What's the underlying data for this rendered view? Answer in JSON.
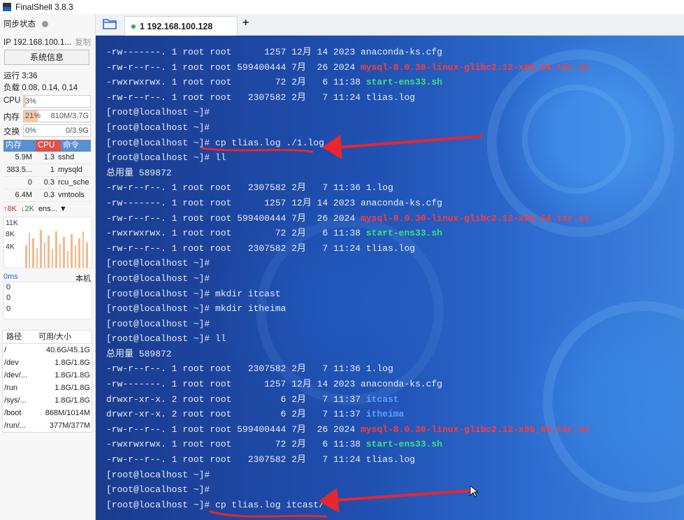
{
  "app": {
    "title": "FinalShell 3.8.3"
  },
  "sidebar": {
    "sync_label": "同步状态",
    "ip_label": "IP 192.168.100.1...",
    "copy_label": "复制",
    "sysinfo_button": "系统信息",
    "uptime": "运行 3:36",
    "load": "负载 0.08, 0.14, 0.14",
    "cpu": {
      "label": "CPU",
      "value": "3%",
      "fraction": 0.03
    },
    "mem": {
      "label": "内存",
      "value": "21%",
      "detail": "810M/3.7G",
      "fraction": 0.21
    },
    "swap": {
      "label": "交换",
      "value": "0%",
      "detail": "0/3.9G",
      "fraction": 0.0
    },
    "process_headers": [
      "内存",
      "CPU",
      "命令"
    ],
    "processes": [
      {
        "mem": "5.9M",
        "cpu": "1.3",
        "cmd": "sshd"
      },
      {
        "mem": "383.5...",
        "cpu": "1",
        "cmd": "mysqld"
      },
      {
        "mem": "0",
        "cpu": "0.3",
        "cmd": "rcu_sche"
      },
      {
        "mem": "6.4M",
        "cpu": "0.3",
        "cmd": "vmtools"
      }
    ],
    "net": {
      "up": "8K",
      "down": "2K",
      "iface": "ens...",
      "y_labels": [
        "11K",
        "8K",
        "4K"
      ]
    },
    "latency": {
      "label": "0ms",
      "host": "本机",
      "values": [
        "0",
        "0",
        "0"
      ]
    },
    "disk": {
      "headers": [
        "路径",
        "可用/大小"
      ],
      "rows": [
        {
          "path": "/",
          "size": "40.6G/45.1G"
        },
        {
          "path": "/dev",
          "size": "1.8G/1.8G"
        },
        {
          "path": "/dev/...",
          "size": "1.8G/1.8G"
        },
        {
          "path": "/run",
          "size": "1.8G/1.8G"
        },
        {
          "path": "/sys/...",
          "size": "1.8G/1.8G"
        },
        {
          "path": "/boot",
          "size": "868M/1014M"
        },
        {
          "path": "/run/...",
          "size": "377M/377M"
        }
      ]
    }
  },
  "tabs": [
    {
      "label": "1 192.168.100.128"
    }
  ],
  "add_tab": "+",
  "colors": {
    "red": "#ff3b3b",
    "green": "#3ee07a",
    "blue": "#5aa0ff",
    "arrow": "#e8262e"
  },
  "terminal": {
    "lines": [
      [
        {
          "t": "-rw-------. 1 root root      1257 12月 14 2023 anaconda-ks.cfg"
        }
      ],
      [
        {
          "t": "-rw-r--r--. 1 root root 599400444 7月  26 2024 "
        },
        {
          "t": "mysql-8.0.30-linux-glibc2.12-x86_64.tar.xz",
          "c": "red"
        }
      ],
      [
        {
          "t": "-rwxrwxrwx. 1 root root        72 2月   6 11:38 "
        },
        {
          "t": "start-ens33.sh",
          "c": "green"
        }
      ],
      [
        {
          "t": "-rw-r--r--. 1 root root   2307582 2月   7 11:24 tlias.log"
        }
      ],
      [
        {
          "t": "[root@localhost ~]#"
        }
      ],
      [
        {
          "t": "[root@localhost ~]#"
        }
      ],
      [
        {
          "t": "[root@localhost ~]# cp tlias.log ./1.log"
        }
      ],
      [
        {
          "t": "[root@localhost ~]# ll"
        }
      ],
      [
        {
          "t": "总用量 589872"
        }
      ],
      [
        {
          "t": "-rw-r--r--. 1 root root   2307582 2月   7 11:36 1.log"
        }
      ],
      [
        {
          "t": "-rw-------. 1 root root      1257 12月 14 2023 anaconda-ks.cfg"
        }
      ],
      [
        {
          "t": "-rw-r--r--. 1 root root 599400444 7月  26 2024 "
        },
        {
          "t": "mysql-8.0.30-linux-glibc2.12-x86_64.tar.xz",
          "c": "red"
        }
      ],
      [
        {
          "t": "-rwxrwxrwx. 1 root root        72 2月   6 11:38 "
        },
        {
          "t": "start-ens33.sh",
          "c": "green"
        }
      ],
      [
        {
          "t": "-rw-r--r--. 1 root root   2307582 2月   7 11:24 tlias.log"
        }
      ],
      [
        {
          "t": "[root@localhost ~]#"
        }
      ],
      [
        {
          "t": "[root@localhost ~]#"
        }
      ],
      [
        {
          "t": "[root@localhost ~]# mkdir itcast"
        }
      ],
      [
        {
          "t": "[root@localhost ~]# mkdir itheima"
        }
      ],
      [
        {
          "t": "[root@localhost ~]#"
        }
      ],
      [
        {
          "t": "[root@localhost ~]# ll"
        }
      ],
      [
        {
          "t": "总用量 589872"
        }
      ],
      [
        {
          "t": "-rw-r--r--. 1 root root   2307582 2月   7 11:36 1.log"
        }
      ],
      [
        {
          "t": "-rw-------. 1 root root      1257 12月 14 2023 anaconda-ks.cfg"
        }
      ],
      [
        {
          "t": "drwxr-xr-x. 2 root root         6 2月   7 11:37 "
        },
        {
          "t": "itcast",
          "c": "blue"
        }
      ],
      [
        {
          "t": "drwxr-xr-x. 2 root root         6 2月   7 11:37 "
        },
        {
          "t": "itheima",
          "c": "blue"
        }
      ],
      [
        {
          "t": "-rw-r--r--. 1 root root 599400444 7月  26 2024 "
        },
        {
          "t": "mysql-8.0.30-linux-glibc2.12-x86_64.tar.xz",
          "c": "red"
        }
      ],
      [
        {
          "t": "-rwxrwxrwx. 1 root root        72 2月   6 11:38 "
        },
        {
          "t": "start-ens33.sh",
          "c": "green"
        }
      ],
      [
        {
          "t": "-rw-r--r--. 1 root root   2307582 2月   7 11:24 tlias.log"
        }
      ],
      [
        {
          "t": "[root@localhost ~]#"
        }
      ],
      [
        {
          "t": "[root@localhost ~]#"
        }
      ],
      [
        {
          "t": "[root@localhost ~]# cp tlias.log itcast/"
        }
      ]
    ]
  }
}
